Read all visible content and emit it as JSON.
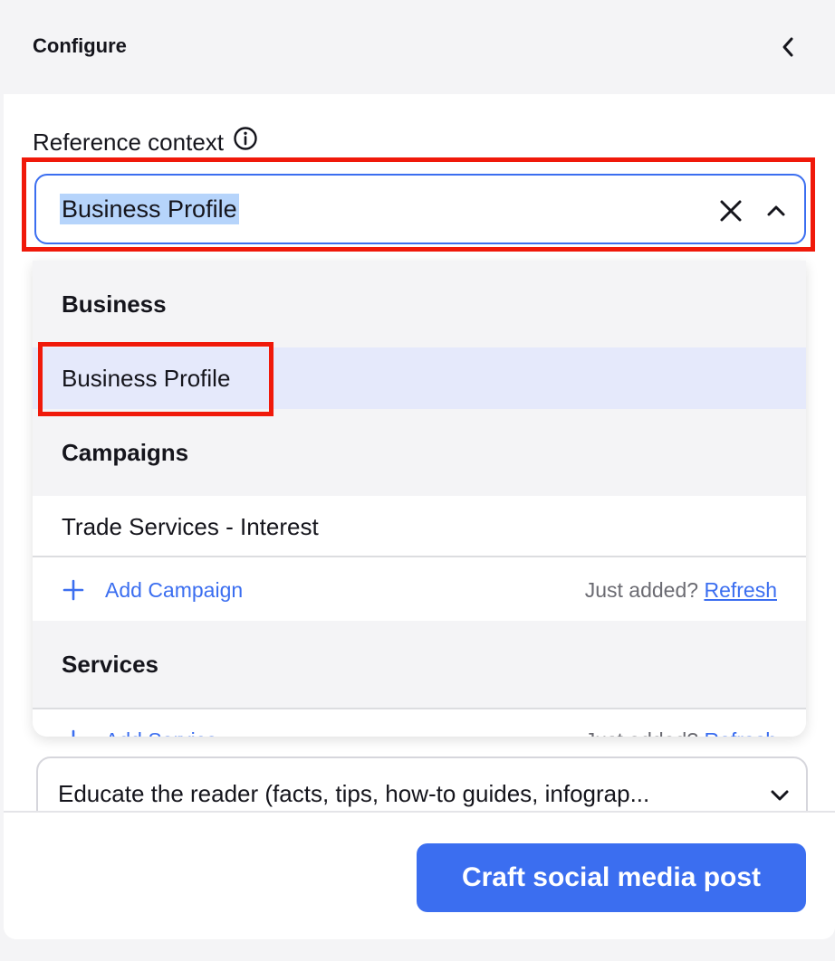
{
  "header": {
    "title": "Configure"
  },
  "reference_context": {
    "label": "Reference context",
    "selected_value": "Business Profile"
  },
  "dropdown": {
    "groups": [
      {
        "title": "Business",
        "options": [
          "Business Profile"
        ]
      },
      {
        "title": "Campaigns",
        "options": [
          "Trade Services - Interest"
        ],
        "add_label": "Add Campaign",
        "just_added": "Just added?",
        "refresh": "Refresh"
      },
      {
        "title": "Services",
        "options": [],
        "add_label": "Add Service",
        "just_added": "Just added?",
        "refresh": "Refresh"
      }
    ]
  },
  "post_goal": {
    "value": "Educate the reader (facts, tips, how-to guides, infograp..."
  },
  "footer": {
    "craft_label": "Craft social media post"
  },
  "colors": {
    "accent": "#3b6ef0",
    "highlight": "#f0190a",
    "selected_option_bg": "#e5e9fb"
  }
}
